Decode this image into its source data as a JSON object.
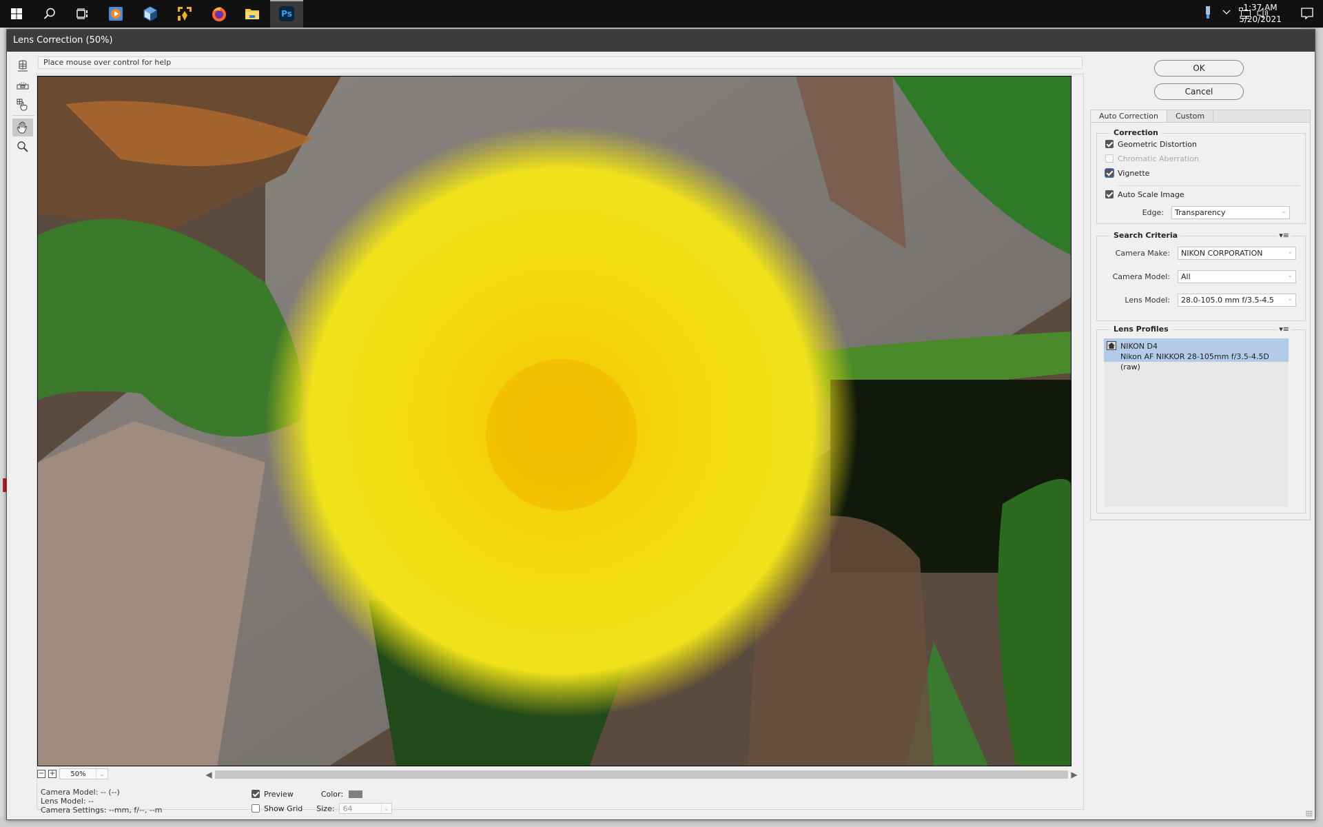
{
  "taskbar": {
    "apps": [
      {
        "name": "start",
        "icon": "windows-logo-icon"
      },
      {
        "name": "search",
        "icon": "search-icon"
      },
      {
        "name": "task-view",
        "icon": "task-view-icon"
      },
      {
        "name": "media-player",
        "icon": "media-player-icon"
      },
      {
        "name": "virtualbox",
        "icon": "virtualbox-icon"
      },
      {
        "name": "yellow-app",
        "icon": "network-app-icon"
      },
      {
        "name": "firefox",
        "icon": "firefox-icon"
      },
      {
        "name": "file-explorer",
        "icon": "folder-icon"
      },
      {
        "name": "photoshop",
        "icon": "photoshop-icon",
        "label": "Ps"
      }
    ],
    "clock": {
      "time": "1:37 AM",
      "date": "5/20/2021"
    }
  },
  "dialog": {
    "title": "Lens Correction (50%)",
    "help_text": "Place mouse over control for help",
    "tools": [
      {
        "name": "remove-distortion-tool",
        "active": false
      },
      {
        "name": "straighten-tool",
        "active": false
      },
      {
        "name": "move-grid-tool",
        "active": false
      },
      {
        "name": "hand-tool",
        "active": true
      },
      {
        "name": "zoom-tool",
        "active": false
      }
    ],
    "zoom": {
      "value": "50%",
      "minus": "−",
      "plus": "+"
    },
    "info": {
      "camera_model": "Camera Model: -- (--)",
      "lens_model": "Lens Model: --",
      "camera_settings": "Camera Settings: --mm, f/--, --m"
    },
    "options": {
      "preview_label": "Preview",
      "preview_checked": true,
      "show_grid_label": "Show Grid",
      "show_grid_checked": false,
      "color_label": "Color:",
      "grid_color": "#808080",
      "size_label": "Size:",
      "size_value": "64"
    },
    "buttons": {
      "ok": "OK",
      "cancel": "Cancel"
    },
    "tabs": [
      {
        "label": "Auto Correction",
        "active": true
      },
      {
        "label": "Custom",
        "active": false
      }
    ],
    "correction": {
      "legend": "Correction",
      "items": [
        {
          "label": "Geometric Distortion",
          "checked": true,
          "enabled": true
        },
        {
          "label": "Chromatic Aberration",
          "checked": false,
          "enabled": false
        },
        {
          "label": "Vignette",
          "checked": true,
          "enabled": true
        }
      ],
      "auto_scale_label": "Auto Scale Image",
      "auto_scale_checked": true,
      "edge_label": "Edge:",
      "edge_value": "Transparency"
    },
    "search_criteria": {
      "legend": "Search Criteria",
      "camera_make_label": "Camera Make:",
      "camera_make_value": "NIKON CORPORATION",
      "camera_model_label": "Camera Model:",
      "camera_model_value": "All",
      "lens_model_label": "Lens Model:",
      "lens_model_value": "28.0-105.0 mm f/3.5-4.5"
    },
    "lens_profiles": {
      "legend": "Lens Profiles",
      "items": [
        {
          "camera": "NIKON D4",
          "lens": "Nikon AF NIKKOR 28-105mm f/3.5-4.5D (raw)",
          "selected": true
        }
      ]
    },
    "photo": {
      "description": "Yellow dandelion flower on weathered wood with green leaves"
    }
  }
}
